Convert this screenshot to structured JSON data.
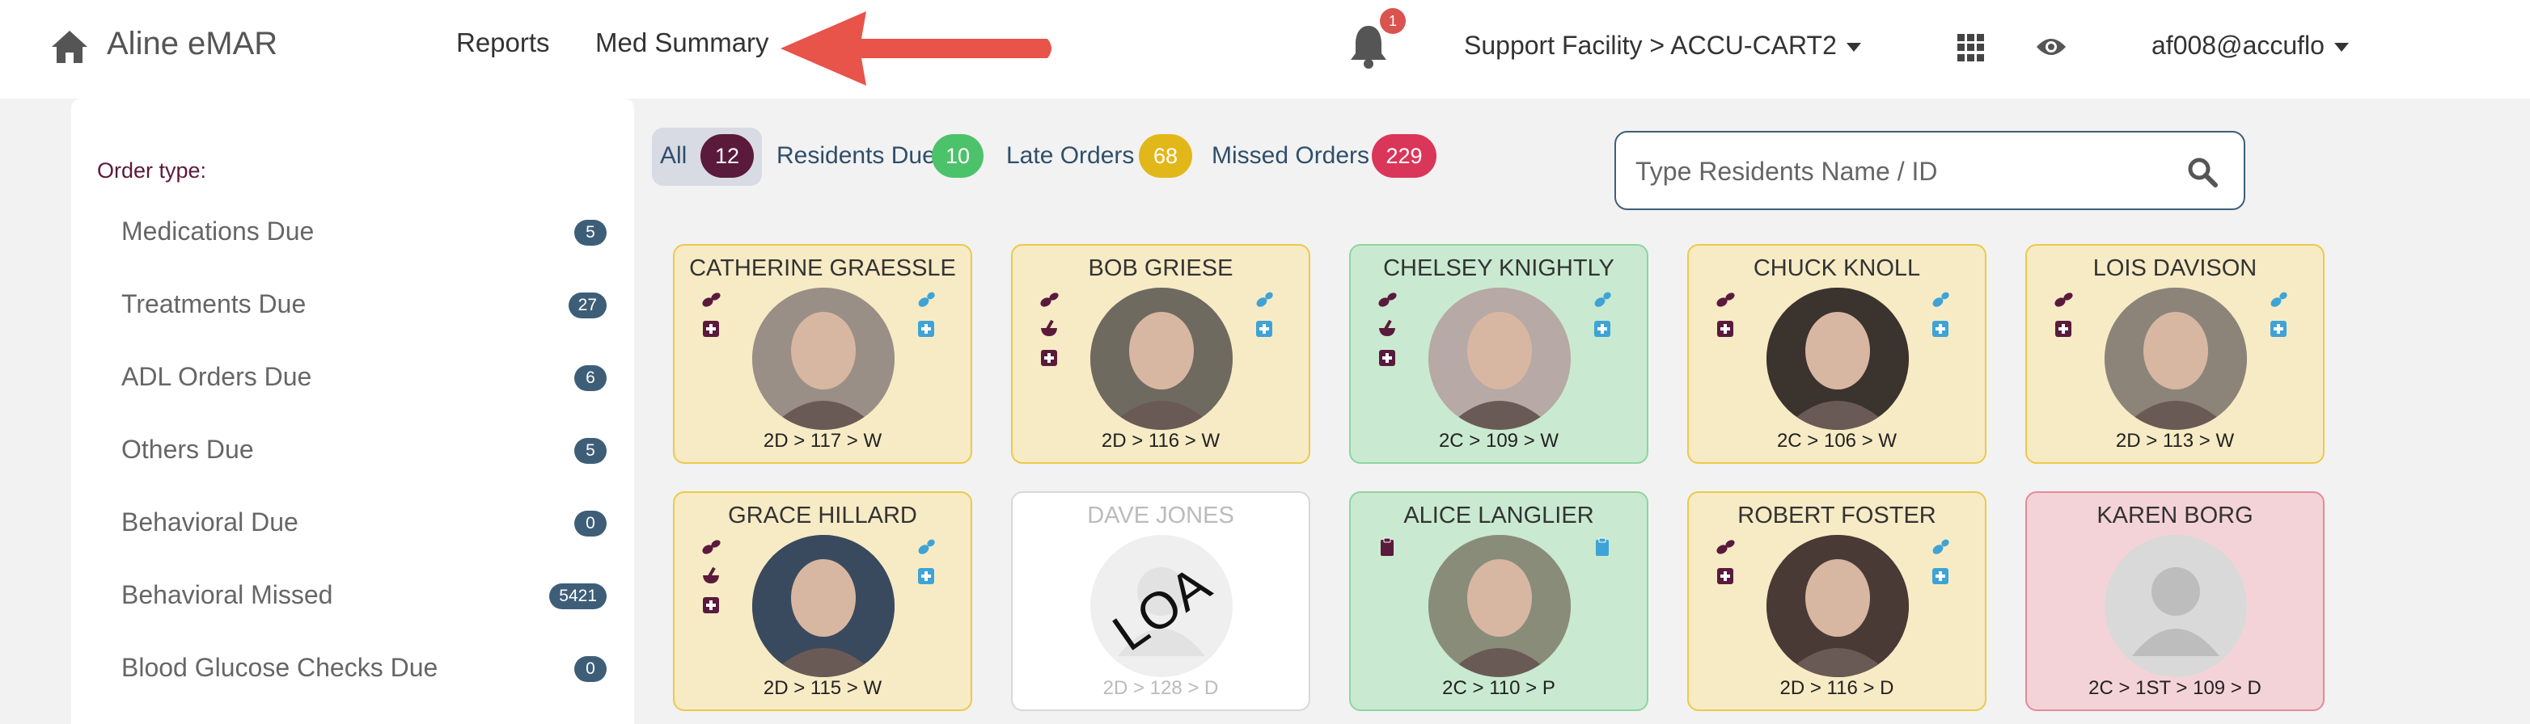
{
  "brand": "Aline eMAR",
  "nav": {
    "reports": "Reports",
    "med_summary": "Med Summary"
  },
  "notifications": {
    "count": "1"
  },
  "facility": "Support Facility > ACCU-CART2",
  "user": "af008@accuflo",
  "sidebar": {
    "heading": "Order type:",
    "items": [
      {
        "label": "Medications Due",
        "count": "5"
      },
      {
        "label": "Treatments Due",
        "count": "27"
      },
      {
        "label": "ADL Orders Due",
        "count": "6"
      },
      {
        "label": "Others Due",
        "count": "5"
      },
      {
        "label": "Behavioral Due",
        "count": "0"
      },
      {
        "label": "Behavioral Missed",
        "count": "5421"
      },
      {
        "label": "Blood Glucose Checks Due",
        "count": "0"
      }
    ]
  },
  "filters": [
    {
      "label": "All",
      "count": "12",
      "color": "#5a1a3c"
    },
    {
      "label": "Residents Due",
      "count": "10",
      "color": "#4cc26a"
    },
    {
      "label": "Late Orders",
      "count": "68",
      "color": "#e2b719"
    },
    {
      "label": "Missed Orders",
      "count": "229",
      "color": "#d9365a"
    }
  ],
  "search": {
    "placeholder": "Type Residents Name / ID"
  },
  "colors": {
    "accent": "#5a1a3c",
    "rx_blue": "#3fa3d6",
    "arrow": "#e8534a"
  },
  "residents": [
    {
      "name": "CATHERINE GRAESSLE",
      "room": "2D > 117 > W",
      "status": "yellow"
    },
    {
      "name": "BOB GRIESE",
      "room": "2D > 116 > W",
      "status": "yellow"
    },
    {
      "name": "CHELSEY KNIGHTLY",
      "room": "2C > 109 > W",
      "status": "green"
    },
    {
      "name": "CHUCK KNOLL",
      "room": "2C > 106 > W",
      "status": "yellow"
    },
    {
      "name": "LOIS DAVISON",
      "room": "2D > 113 > W",
      "status": "yellow"
    },
    {
      "name": "GRACE HILLARD",
      "room": "2D > 115 > W",
      "status": "yellow"
    },
    {
      "name": "DAVE JONES",
      "room": "2D > 128 > D",
      "status": "white",
      "photo_text": "LOA"
    },
    {
      "name": "ALICE LANGLIER",
      "room": "2C > 110 > P",
      "status": "green"
    },
    {
      "name": "ROBERT FOSTER",
      "room": "2D > 116 > D",
      "status": "yellow"
    },
    {
      "name": "KAREN BORG",
      "room": "2C > 1ST > 109 > D",
      "status": "pink"
    }
  ]
}
